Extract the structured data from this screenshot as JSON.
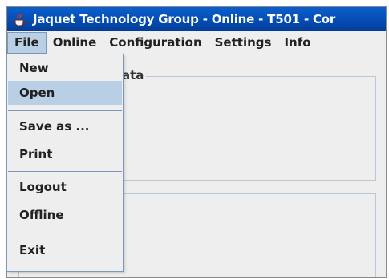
{
  "window": {
    "title": "Jaquet Technology Group - Online - T501 - Cor",
    "icon": "java-cup-icon"
  },
  "menubar": {
    "items": [
      {
        "label": "File",
        "active": true
      },
      {
        "label": "Online"
      },
      {
        "label": "Configuration"
      },
      {
        "label": "Settings"
      },
      {
        "label": "Info"
      }
    ]
  },
  "content": {
    "group1_title": "Data",
    "group1_title_visible": "ata"
  },
  "file_menu": {
    "new": "New",
    "open": "Open",
    "save_as": "Save as ...",
    "print": "Print",
    "logout": "Logout",
    "offline": "Offline",
    "exit": "Exit",
    "selected": "Open"
  },
  "colors": {
    "title_bar": "#044bb0",
    "menu_highlight": "#b8cfe5",
    "menu_border": "#7a98b8",
    "background": "#eeeeee"
  }
}
